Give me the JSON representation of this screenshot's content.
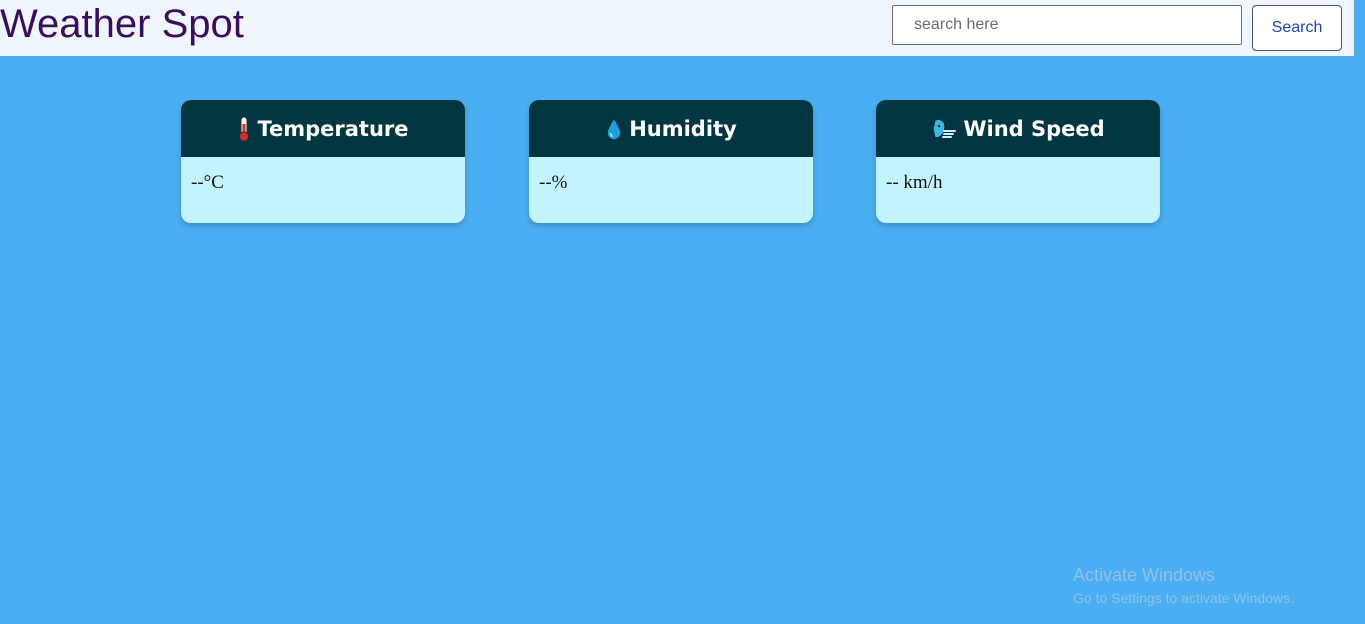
{
  "app": {
    "title": "Weather Spot"
  },
  "search": {
    "placeholder": "search here",
    "value": "",
    "button_label": "Search"
  },
  "cards": [
    {
      "icon": "thermometer-icon",
      "title": "Temperature",
      "value": "--°C"
    },
    {
      "icon": "droplet-icon",
      "title": "Humidity",
      "value": "--%"
    },
    {
      "icon": "wind-face-icon",
      "title": "Wind Speed",
      "value": "-- km/h"
    }
  ],
  "watermark": {
    "title": "Activate Windows",
    "subtitle": "Go to Settings to activate Windows."
  },
  "colors": {
    "page_background": "#4aaef2",
    "navbar_background": "#eff6fd",
    "brand_text": "#3a0d5e",
    "card_header": "#023641",
    "card_body": "#c3f3fd",
    "button_text": "#1f44b5"
  }
}
